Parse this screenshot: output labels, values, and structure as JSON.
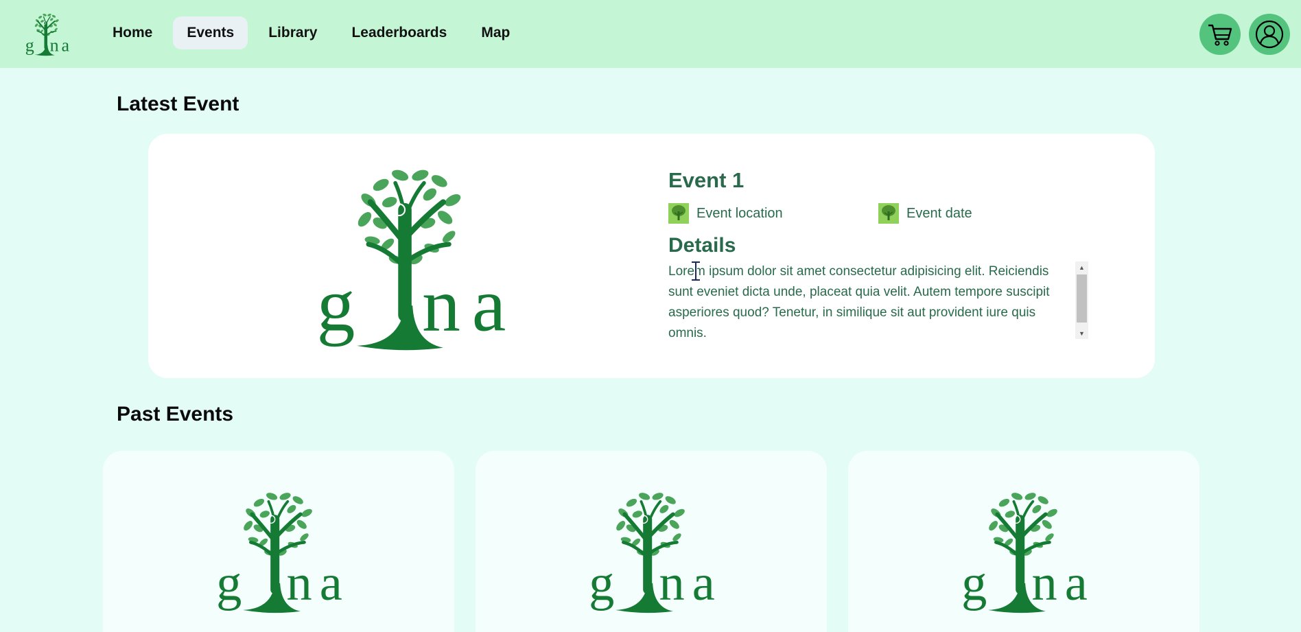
{
  "brand": {
    "logo_text": "gina"
  },
  "nav": {
    "items": [
      {
        "label": "Home",
        "active": false
      },
      {
        "label": "Events",
        "active": true
      },
      {
        "label": "Library",
        "active": false
      },
      {
        "label": "Leaderboards",
        "active": false
      },
      {
        "label": "Map",
        "active": false
      }
    ],
    "cart_icon": "cart-icon",
    "profile_icon": "user-icon"
  },
  "latest": {
    "section_title": "Latest Event",
    "event": {
      "title": "Event 1",
      "location": "Event location",
      "date": "Event date",
      "details_title": "Details",
      "details_text": "Lorem ipsum dolor sit amet consectetur adipisicing elit. Reiciendis sunt eveniet dicta unde, placeat quia velit. Autem tempore suscipit asperiores quod? Tenetur, in similique sit aut provident iure quis omnis."
    }
  },
  "past": {
    "section_title": "Past Events",
    "cards": [
      {
        "logo_text": "gina"
      },
      {
        "logo_text": "gina"
      },
      {
        "logo_text": "gina"
      }
    ]
  },
  "colors": {
    "nav_bg": "#c4f6d6",
    "page_bg": "#e3fdf6",
    "accent_green": "#54c37d",
    "logo_green": "#157a34",
    "leaf_green": "#4aa55a",
    "text_green": "#286a4b"
  }
}
